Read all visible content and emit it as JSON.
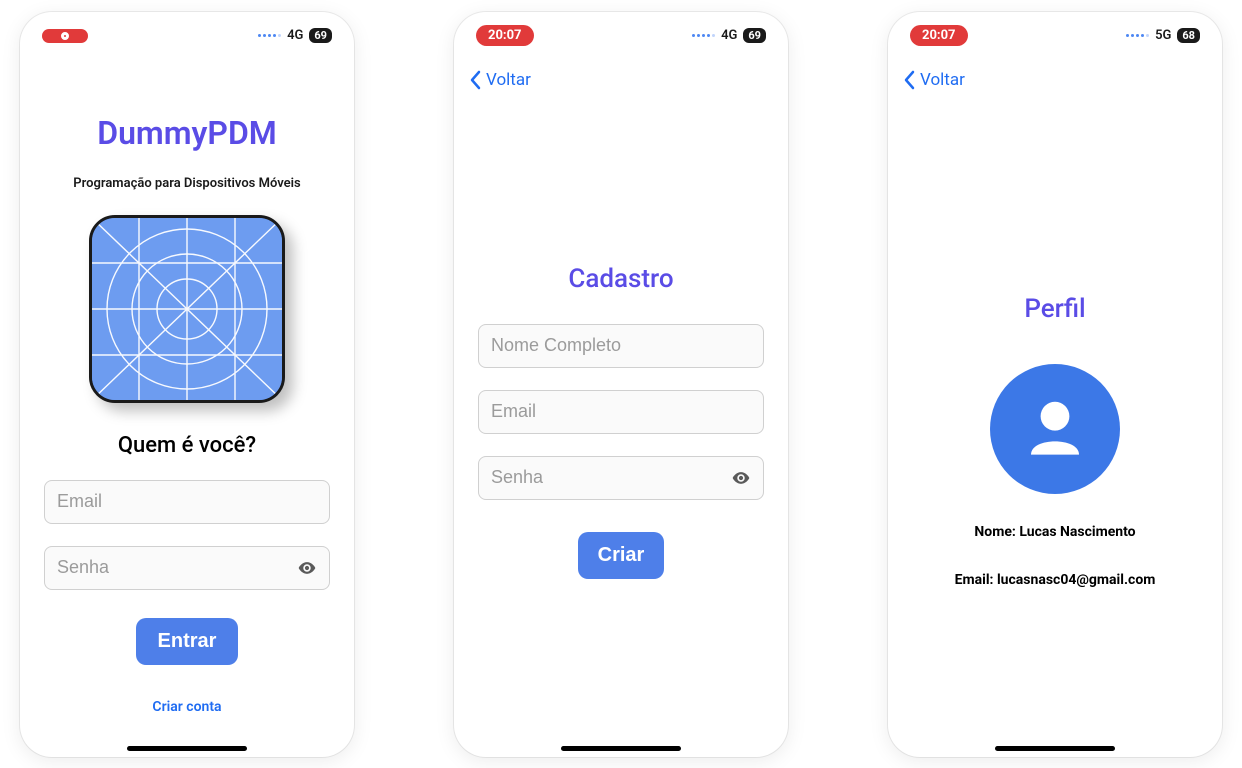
{
  "screen1": {
    "status": {
      "time": "",
      "network": "4G",
      "battery": "69",
      "recording": true
    },
    "title": "DummyPDM",
    "subtitle": "Programação para Dispositivos Móveis",
    "question": "Quem é você?",
    "fields": {
      "email_placeholder": "Email",
      "senha_placeholder": "Senha"
    },
    "primary_button": "Entrar",
    "create_link": "Criar conta"
  },
  "screen2": {
    "status": {
      "time": "20:07",
      "network": "4G",
      "battery": "69"
    },
    "back_label": "Voltar",
    "title": "Cadastro",
    "fields": {
      "nome_placeholder": "Nome Completo",
      "email_placeholder": "Email",
      "senha_placeholder": "Senha"
    },
    "primary_button": "Criar"
  },
  "screen3": {
    "status": {
      "time": "20:07",
      "network": "5G",
      "battery": "68"
    },
    "back_label": "Voltar",
    "title": "Perfil",
    "name_line": "Nome: Lucas Nascimento",
    "email_line": "Email: lucasnasc04@gmail.com"
  }
}
